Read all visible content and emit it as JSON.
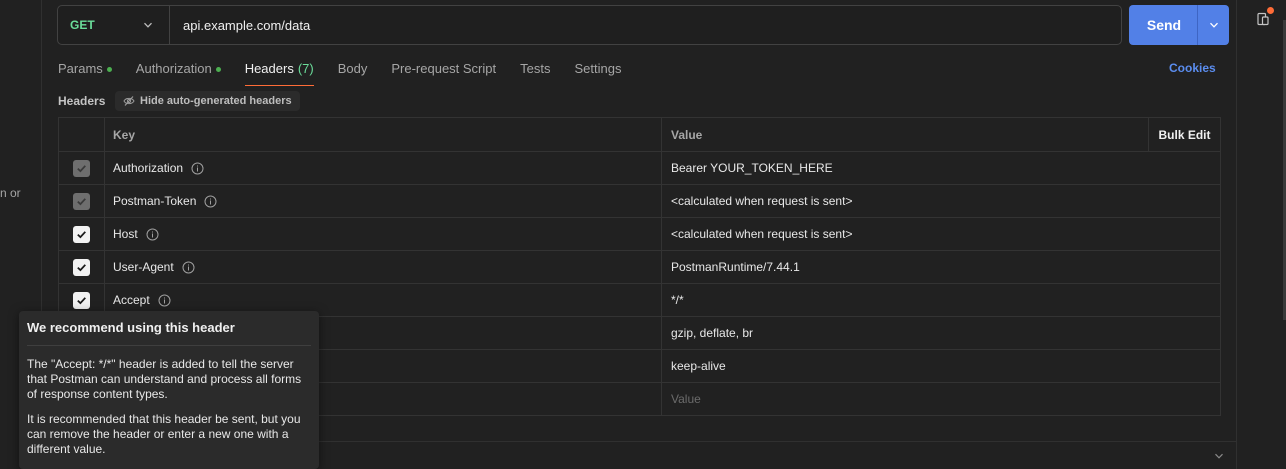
{
  "left_panel": {
    "cut_text": "n or"
  },
  "request": {
    "method": "GET",
    "url": "api.example.com/data",
    "send_label": "Send"
  },
  "tabs": [
    {
      "label": "Params",
      "dot": true
    },
    {
      "label": "Authorization",
      "dot": true
    },
    {
      "label": "Headers",
      "count": "(7)",
      "active": true
    },
    {
      "label": "Body"
    },
    {
      "label": "Pre-request Script"
    },
    {
      "label": "Tests"
    },
    {
      "label": "Settings"
    }
  ],
  "cookies_label": "Cookies",
  "headers_section": {
    "label": "Headers",
    "hide_auto_label": "Hide auto-generated headers"
  },
  "table": {
    "columns": {
      "key": "Key",
      "value": "Value",
      "bulk_edit": "Bulk Edit"
    },
    "rows": [
      {
        "key": "Authorization",
        "value": "Bearer YOUR_TOKEN_HERE",
        "checked": true,
        "locked": true
      },
      {
        "key": "Postman-Token",
        "value": "<calculated when request is sent>",
        "checked": true,
        "locked": true
      },
      {
        "key": "Host",
        "value": "<calculated when request is sent>",
        "checked": true
      },
      {
        "key": "User-Agent",
        "value": "PostmanRuntime/7.44.1",
        "checked": true
      },
      {
        "key": "Accept",
        "value": "*/*",
        "checked": true
      },
      {
        "key": "",
        "value": "gzip, deflate, br"
      },
      {
        "key": "",
        "value": "keep-alive"
      }
    ],
    "new_row_value_placeholder": "Value"
  },
  "tooltip": {
    "title": "We recommend using this header",
    "paragraph1": "The \"Accept: */*\" header is added to tell the server that Postman can understand and process all forms of response content types.",
    "paragraph2": "It is recommended that this header be sent, but you can remove the header or enter a new one with a different value."
  },
  "colors": {
    "accent": "#ff6c37",
    "send": "#5280e7",
    "method_get": "#6bdd9a",
    "link": "#5b8def"
  }
}
